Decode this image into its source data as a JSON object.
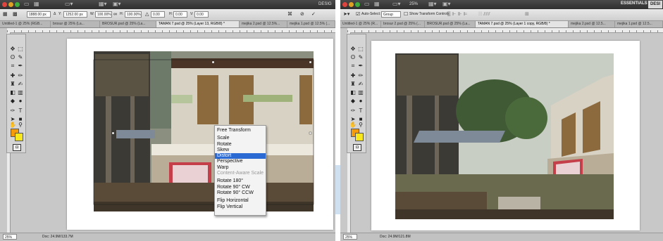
{
  "colors": {
    "foreground": "#f49b0b",
    "background": "#f8e71c",
    "menu_highlight": "#2a6ad2"
  },
  "left": {
    "menubar": {
      "partial_label": "DESIG"
    },
    "options": {
      "x_value": "1888.00 px",
      "delta_label": "Δ",
      "y_label": "Y:",
      "y_value": "1252.00 px",
      "w_label": "W:",
      "w_value": "100.00%",
      "h_label": "H:",
      "h_value": "100.00%",
      "angle_value": "0.00",
      "h_skew_label": "H:",
      "h_skew_value": "0.00",
      "v_skew_label": "V:",
      "v_skew_value": "0.00"
    },
    "tabs": [
      "Untitled-1 @ 25% (RGB...",
      "brosur @ 25% (La...",
      "BROSUR.psd @ 25% (La...",
      "TAMAN 7.psd @ 25% (Layer 13, RGB/8) *",
      "mejika 2.psd @ 12.5%...",
      "mejika 1.psd @ 12.5% (..."
    ],
    "status": {
      "zoom": "25%",
      "doc": "Doc: 24.9M/133.7M"
    },
    "context_menu": {
      "items": [
        {
          "label": "Free Transform",
          "state": "normal"
        },
        {
          "sep": true
        },
        {
          "label": "Scale",
          "state": "normal"
        },
        {
          "label": "Rotate",
          "state": "normal"
        },
        {
          "label": "Skew",
          "state": "normal"
        },
        {
          "label": "Distort",
          "state": "highlight"
        },
        {
          "label": "Perspective",
          "state": "normal"
        },
        {
          "label": "Warp",
          "state": "normal"
        },
        {
          "label": "Content-Aware Scale",
          "state": "disabled"
        },
        {
          "sep": true
        },
        {
          "label": "Rotate 180°",
          "state": "normal"
        },
        {
          "label": "Rotate 90° CW",
          "state": "normal"
        },
        {
          "label": "Rotate 90° CCW",
          "state": "normal"
        },
        {
          "sep": true
        },
        {
          "label": "Flip Horizontal",
          "state": "normal"
        },
        {
          "label": "Flip Vertical",
          "state": "normal"
        }
      ]
    }
  },
  "right": {
    "menubar": {
      "zoom": "25%",
      "essentials": "ESSENTIALS",
      "design": "DESI"
    },
    "options": {
      "auto_select_label": "Auto-Select:",
      "group_value": "Group",
      "show_transform_label": "Show Transform Controls"
    },
    "tabs": [
      "Untitled-1 @ 25% (R...",
      "brosur 2.psd @ 25% (...",
      "BROSUR.psd @ 25% (La...",
      "TAMAN 7.psd @ 25% (Layer 1 copy, RGB/8) *",
      "mejika 2.psd @ 12.5...",
      "mejika 1.psd @ 12.5..."
    ],
    "status": {
      "zoom": "25%",
      "doc": "Doc: 24.9M/121.8M"
    }
  }
}
